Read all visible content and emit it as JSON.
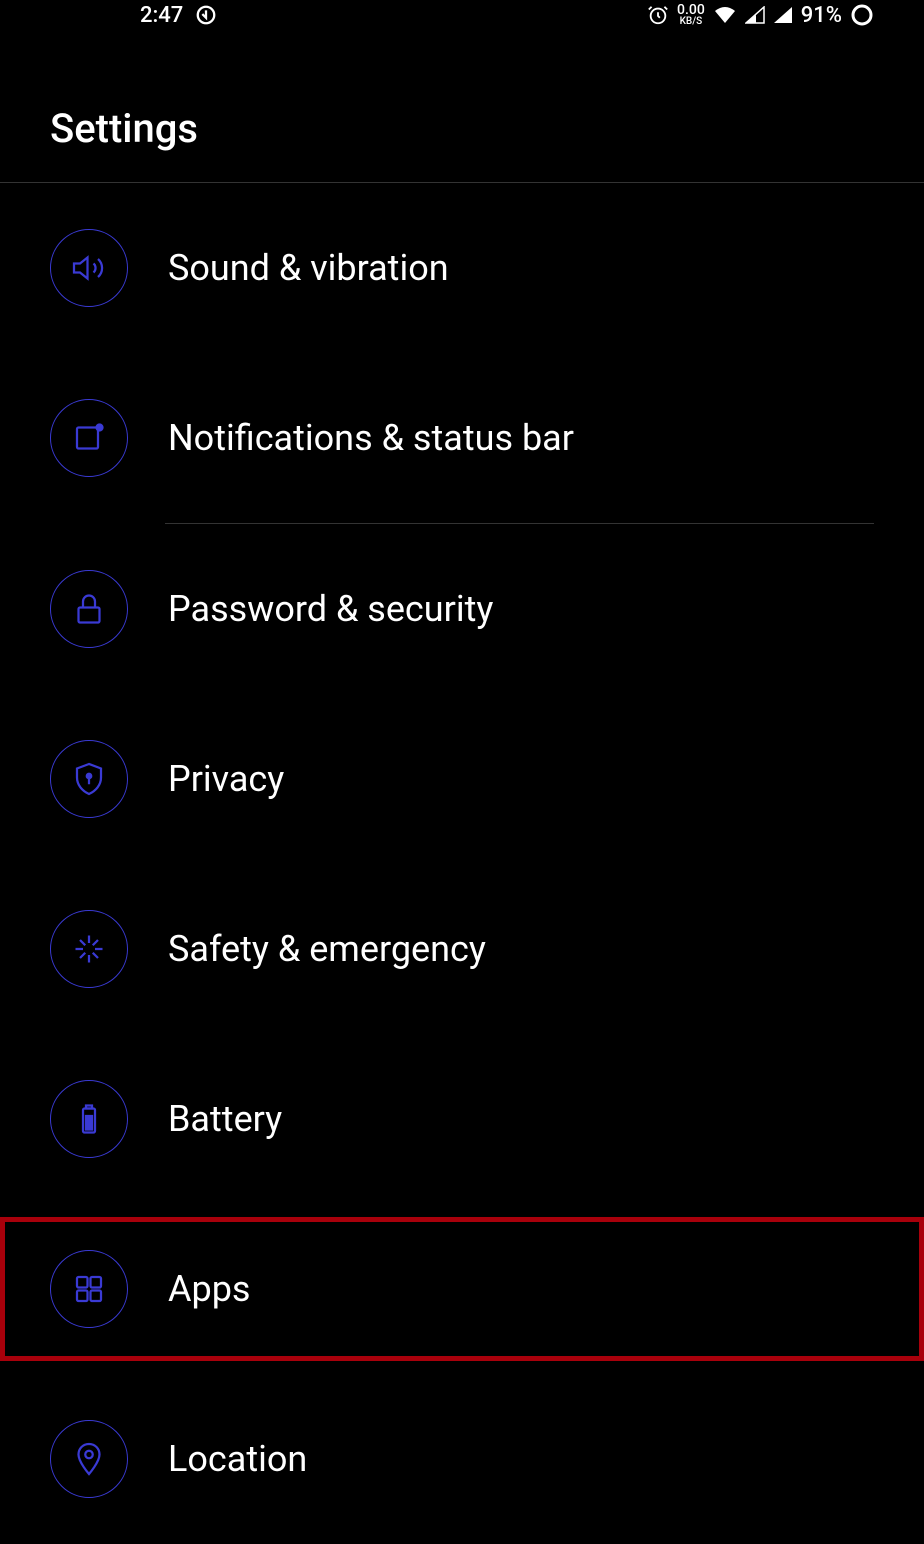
{
  "status_bar": {
    "time": "2:47",
    "data_rate": "0.00",
    "data_unit": "KB/S",
    "battery_percent": "91%"
  },
  "page_title": "Settings",
  "items": [
    {
      "label": "Sound & vibration",
      "icon": "sound-icon",
      "highlighted": false
    },
    {
      "label": "Notifications & status bar",
      "icon": "notifications-icon",
      "highlighted": false,
      "divider_after": true
    },
    {
      "label": "Password & security",
      "icon": "lock-icon",
      "highlighted": false
    },
    {
      "label": "Privacy",
      "icon": "privacy-icon",
      "highlighted": false
    },
    {
      "label": "Safety & emergency",
      "icon": "emergency-icon",
      "highlighted": false
    },
    {
      "label": "Battery",
      "icon": "battery-icon",
      "highlighted": false
    },
    {
      "label": "Apps",
      "icon": "apps-icon",
      "highlighted": true
    },
    {
      "label": "Location",
      "icon": "location-icon",
      "highlighted": false
    }
  ]
}
